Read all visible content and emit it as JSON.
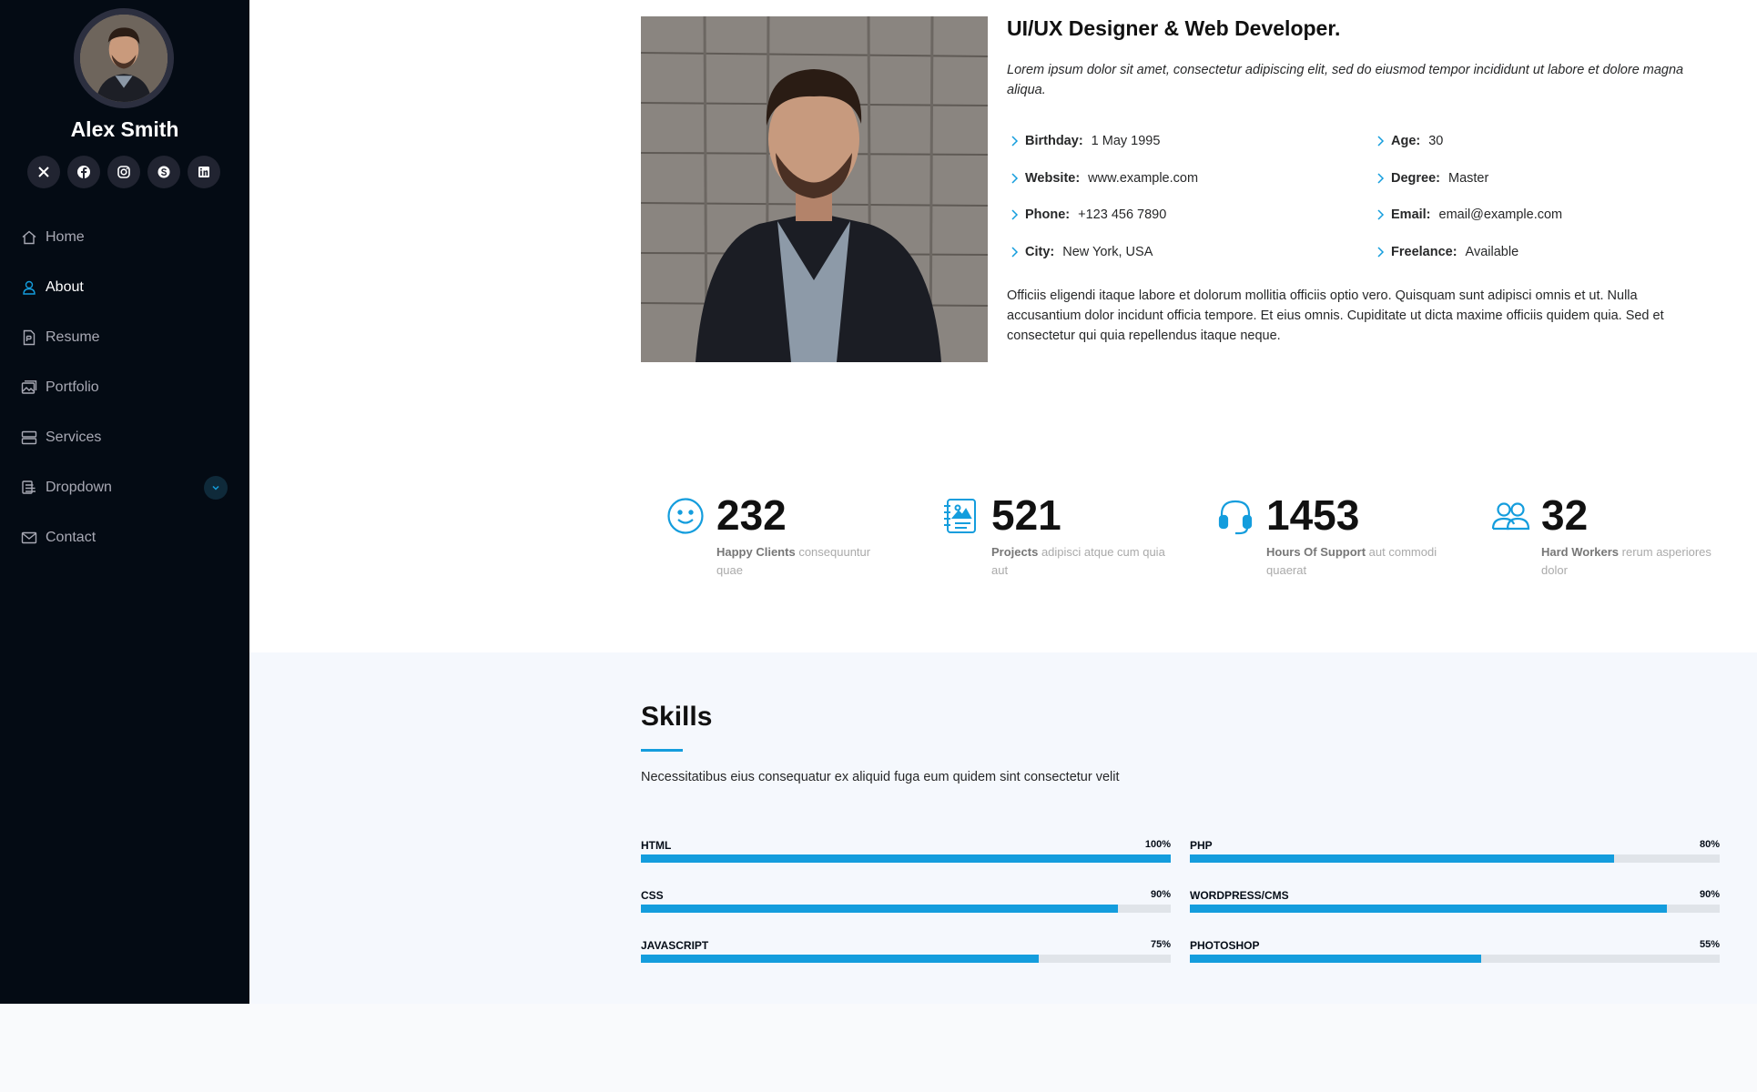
{
  "colors": {
    "accent": "#149ddd",
    "sidebar_bg": "#040b14",
    "skills_bg": "#f5f8fd"
  },
  "profile": {
    "name": "Alex Smith"
  },
  "social": [
    {
      "icon": "x-twitter-icon"
    },
    {
      "icon": "facebook-icon"
    },
    {
      "icon": "instagram-icon"
    },
    {
      "icon": "skype-icon"
    },
    {
      "icon": "linkedin-icon"
    }
  ],
  "nav": {
    "items": [
      {
        "label": "Home",
        "icon": "house-icon",
        "active": false
      },
      {
        "label": "About",
        "icon": "person-icon",
        "active": true
      },
      {
        "label": "Resume",
        "icon": "file-icon",
        "active": false
      },
      {
        "label": "Portfolio",
        "icon": "images-icon",
        "active": false
      },
      {
        "label": "Services",
        "icon": "hdd-stack-icon",
        "active": false
      },
      {
        "label": "Dropdown",
        "icon": "menu-icon",
        "active": false
      },
      {
        "label": "Contact",
        "icon": "envelope-icon",
        "active": false
      }
    ]
  },
  "about": {
    "title": "UI/UX Designer & Web Developer.",
    "intro": "Lorem ipsum dolor sit amet, consectetur adipiscing elit, sed do eiusmod tempor incididunt ut labore et dolore magna aliqua.",
    "left": [
      {
        "label": "Birthday:",
        "value": "1 May 1995"
      },
      {
        "label": "Website:",
        "value": "www.example.com"
      },
      {
        "label": "Phone:",
        "value": "+123 456 7890"
      },
      {
        "label": "City:",
        "value": "New York, USA"
      }
    ],
    "right": [
      {
        "label": "Age:",
        "value": "30"
      },
      {
        "label": "Degree:",
        "value": "Master"
      },
      {
        "label": "Email:",
        "value": "email@example.com"
      },
      {
        "label": "Freelance:",
        "value": "Available"
      }
    ],
    "body": "Officiis eligendi itaque labore et dolorum mollitia officiis optio vero. Quisquam sunt adipisci omnis et ut. Nulla accusantium dolor incidunt officia tempore. Et eius omnis. Cupiditate ut dicta maxime officiis quidem quia. Sed et consectetur qui quia repellendus itaque neque."
  },
  "stats": [
    {
      "icon": "emoji-smile-icon",
      "number": "232",
      "strong": "Happy Clients",
      "rest": "consequuntur quae"
    },
    {
      "icon": "journal-richtext-icon",
      "number": "521",
      "strong": "Projects",
      "rest": "adipisci atque cum quia aut"
    },
    {
      "icon": "headset-icon",
      "number": "1453",
      "strong": "Hours Of Support",
      "rest": "aut commodi quaerat"
    },
    {
      "icon": "people-icon",
      "number": "32",
      "strong": "Hard Workers",
      "rest": "rerum asperiores dolor"
    }
  ],
  "skills": {
    "title": "Skills",
    "description": "Necessitatibus eius consequatur ex aliquid fuga eum quidem sint consectetur velit",
    "left": [
      {
        "name": "HTML",
        "percent_label": "100%",
        "percent": 100
      },
      {
        "name": "CSS",
        "percent_label": "90%",
        "percent": 90
      },
      {
        "name": "JavaScript",
        "percent_label": "75%",
        "percent": 75
      }
    ],
    "right": [
      {
        "name": "PHP",
        "percent_label": "80%",
        "percent": 80
      },
      {
        "name": "WordPress/CMS",
        "percent_label": "90%",
        "percent": 90
      },
      {
        "name": "Photoshop",
        "percent_label": "55%",
        "percent": 55
      }
    ]
  }
}
